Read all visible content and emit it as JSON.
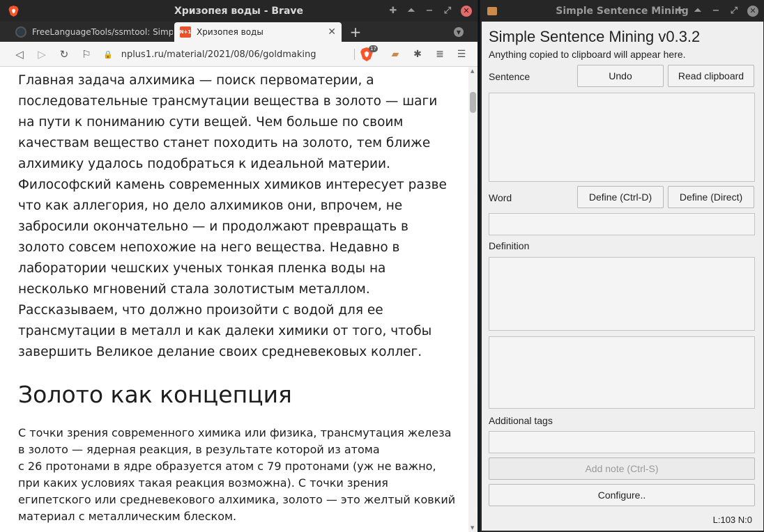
{
  "browser": {
    "window_title": "Хризопея воды - Brave",
    "tabs": [
      {
        "label": "FreeLanguageTools/ssmtool: Simpl",
        "active": false
      },
      {
        "label": "Хризопея воды",
        "active": true,
        "favicon_text": "N+1"
      }
    ],
    "url": "nplus1.ru/material/2021/08/06/goldmaking",
    "shield_count": "17",
    "article": {
      "lead": "Главная задача алхимика — поиск первоматерии, а последовательные трансмутации вещества в золото — шаги на пути к пониманию сути вещей. Чем больше по своим качествам вещество станет походить на золото, тем ближе алхимику удалось подобраться к идеальной материи. Философский камень современных химиков интересует разве что как аллегория, но дело алхимиков они, впрочем, не забросили окончательно — и продолжают превращать в золото совсем непохожие на него вещества. Недавно в лаборатории чешских ученых тонкая пленка воды на несколько мгновений стала золотистым металлом. Рассказываем, что должно произойти с водой для ее трансмутации в металл и как далеки химики от того, чтобы завершить Великое делание своих средневековых коллег.",
      "section_title": "Золото как концепция",
      "body_lines": [
        "С точки зрения современного химика или физика, трансмутация железа",
        "в золото — ядерная реакция, в результате которой из атома",
        "с 26 протонами в ядре образуется атом с 79 протонами (уж не важно,",
        "при каких условиях такая реакция возможна). С точки зрения",
        "египетского или средневекового алхимика, золото — это желтый ковкий",
        "материал с металлическим блеском."
      ]
    }
  },
  "ssm": {
    "window_title": "Simple Sentence Mining",
    "heading": "Simple Sentence Mining v0.3.2",
    "subtitle": "Anything copied to clipboard will appear here.",
    "sentence_label": "Sentence",
    "undo_label": "Undo",
    "read_clipboard_label": "Read clipboard",
    "word_label": "Word",
    "define_label": "Define (Ctrl-D)",
    "define_direct_label": "Define (Direct)",
    "definition_label": "Definition",
    "additional_tags_label": "Additional tags",
    "add_note_label": "Add note (Ctrl-S)",
    "configure_label": "Configure..",
    "status": "L:103 N:0"
  },
  "colors": {
    "titlebar": "#262626",
    "close_button": "#e06c6c",
    "brave_orange": "#fb542b"
  }
}
